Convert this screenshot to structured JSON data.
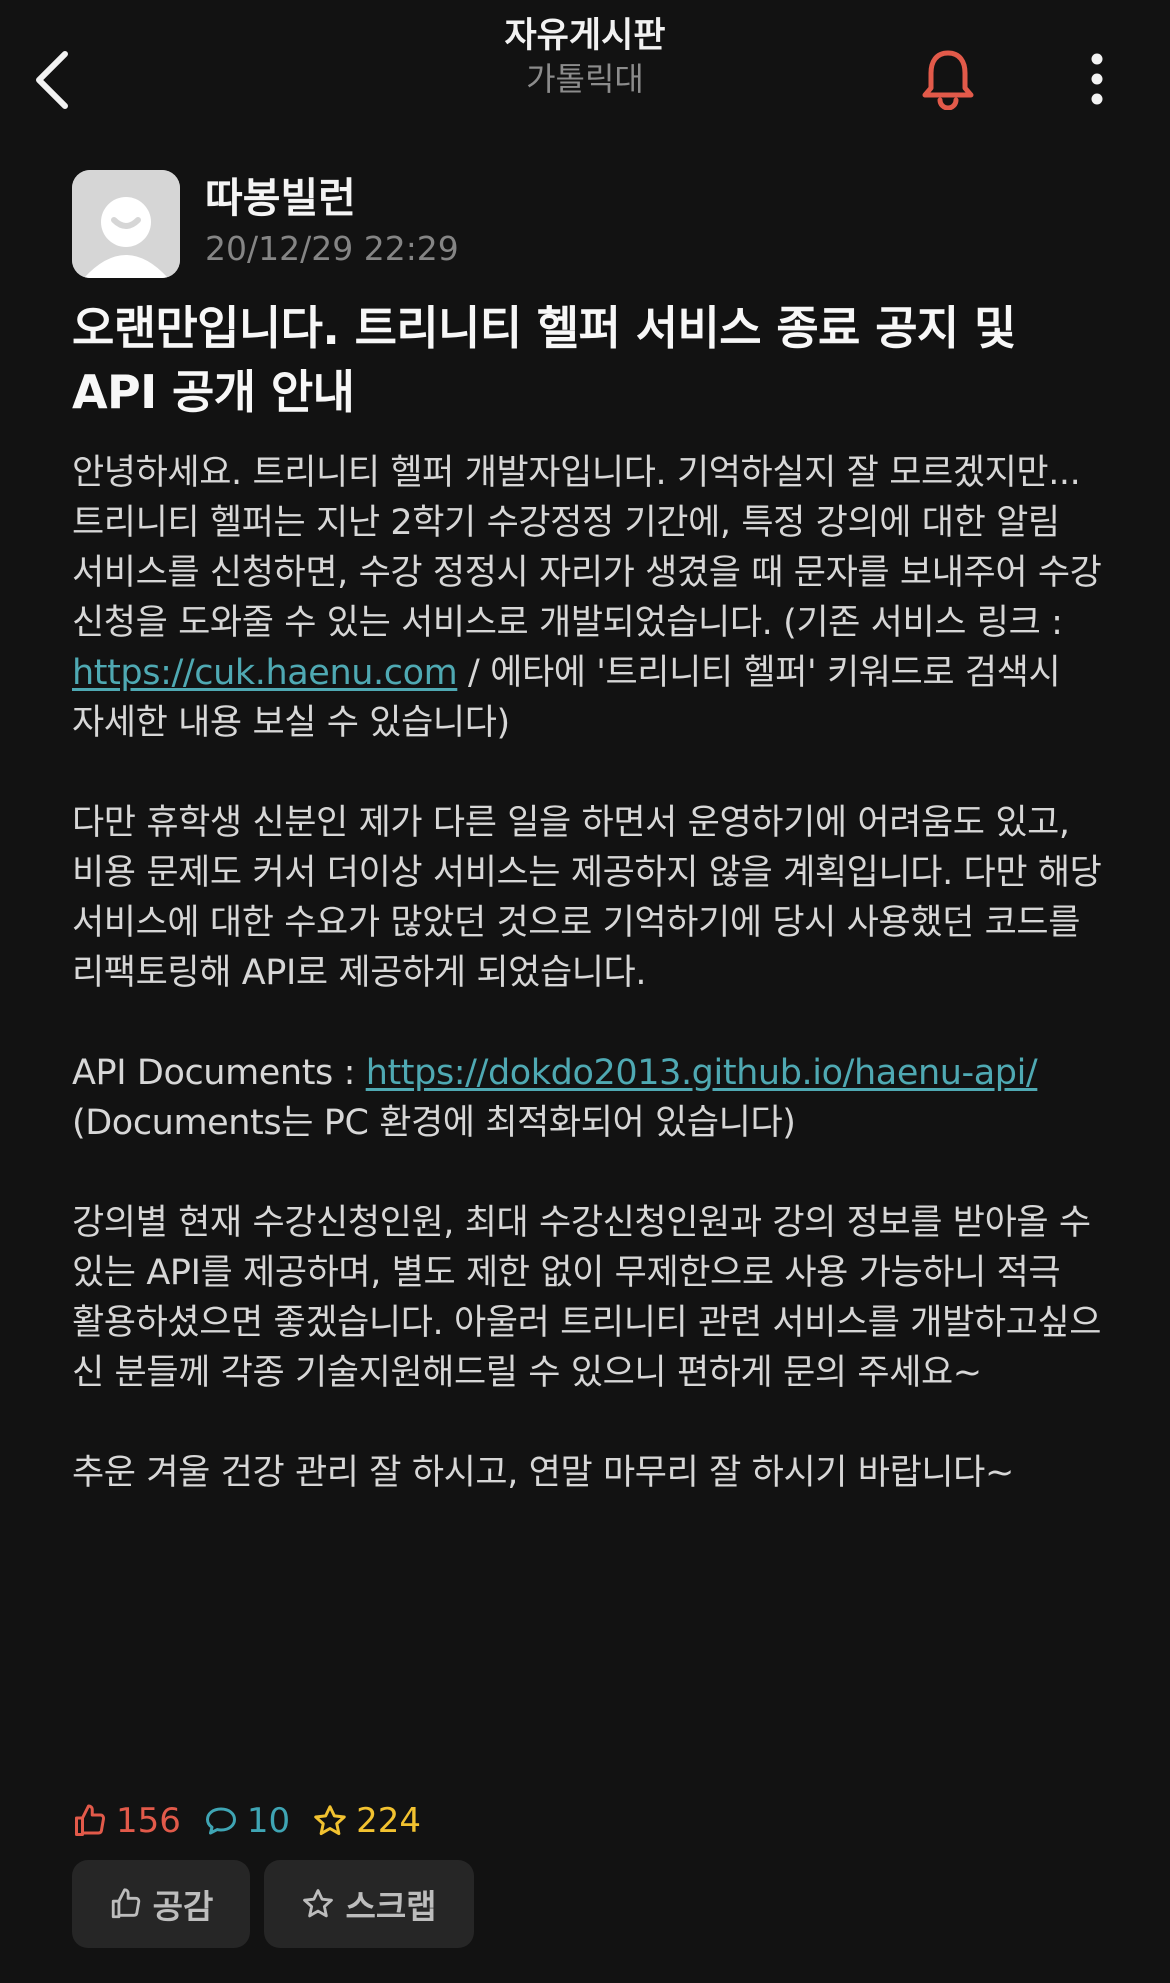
{
  "header": {
    "board_title": "자유게시판",
    "school": "가톨릭대"
  },
  "author": {
    "name": "따봉빌런",
    "time": "20/12/29 22:29"
  },
  "post": {
    "title": "오랜만입니다. 트리니티 헬퍼 서비스 종료 공지 및 API 공개 안내",
    "p1_before": "안녕하세요. 트리니티 헬퍼 개발자입니다. 기억하실지 잘 모르겠지만... 트리니티 헬퍼는 지난 2학기 수강정정 기간에, 특정 강의에 대한 알림 서비스를 신청하면, 수강 정정시 자리가 생겼을 때 문자를 보내주어 수강신청을 도와줄 수 있는 서비스로 개발되었습니다. (기존 서비스 링크 : ",
    "link1": "https://cuk.haenu.com",
    "p1_after": " / 에타에 '트리니티 헬퍼' 키워드로 검색시 자세한 내용 보실 수 있습니다)",
    "p2": "다만 휴학생 신분인 제가 다른 일을 하면서 운영하기에 어려움도 있고, 비용 문제도 커서 더이상 서비스는 제공하지 않을 계획입니다. 다만 해당 서비스에 대한 수요가 많았던 것으로 기억하기에 당시 사용했던 코드를 리팩토링해 API로 제공하게 되었습니다.",
    "p3_label": "API Documents : ",
    "link2": "https://dokdo2013.github.io/haenu-api/",
    "p3_note": "(Documents는 PC 환경에 최적화되어 있습니다)",
    "p4": "강의별 현재 수강신청인원, 최대 수강신청인원과 강의 정보를 받아올 수 있는 API를 제공하며, 별도 제한 없이 무제한으로 사용 가능하니 적극 활용하셨으면 좋겠습니다. 아울러 트리니티 관련 서비스를 개발하고싶으신 분들께 각종 기술지원해드릴 수 있으니 편하게 문의 주세요~",
    "p5": "추운 겨울 건강 관리 잘 하시고, 연말 마무리 잘 하시기 바랍니다~"
  },
  "stats": {
    "likes": "156",
    "comments": "10",
    "scraps": "224"
  },
  "actions": {
    "like_label": "공감",
    "scrap_label": "스크랩"
  },
  "colors": {
    "background": "#121212",
    "like": "#e25a4a",
    "comment": "#3fa5b4",
    "scrap": "#f2c230",
    "link": "#4fa9b3",
    "bell": "#e25a4a"
  },
  "icons": {
    "back": "chevron-left-icon",
    "bell": "bell-icon",
    "more": "more-vertical-icon",
    "like": "thumbs-up-icon",
    "comment": "comment-icon",
    "scrap": "star-icon"
  }
}
